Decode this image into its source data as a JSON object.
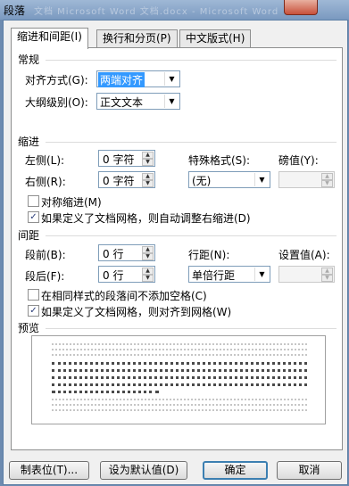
{
  "window": {
    "title": "段落",
    "background_caption": "文档 Microsoft Word 文档.docx - Microsoft Word",
    "close_glyph": "✕"
  },
  "tabs": [
    {
      "label": "缩进和间距(I)",
      "active": true
    },
    {
      "label": "换行和分页(P)",
      "active": false
    },
    {
      "label": "中文版式(H)",
      "active": false
    }
  ],
  "general": {
    "title": "常规",
    "alignment_label": "对齐方式(G):",
    "alignment_value": "两端对齐",
    "outline_label": "大纲级别(O):",
    "outline_value": "正文文本"
  },
  "indent": {
    "title": "缩进",
    "left_label": "左侧(L):",
    "left_value": "0 字符",
    "right_label": "右侧(R):",
    "right_value": "0 字符",
    "special_label": "特殊格式(S):",
    "special_value": "(无)",
    "by_label": "磅值(Y):",
    "by_value": "",
    "mirror_label": "对称缩进(M)",
    "mirror_checked": false,
    "auto_adjust_label": "如果定义了文档网格，则自动调整右缩进(D)",
    "auto_adjust_checked": true
  },
  "spacing": {
    "title": "间距",
    "before_label": "段前(B):",
    "before_value": "0 行",
    "after_label": "段后(F):",
    "after_value": "0 行",
    "line_label": "行距(N):",
    "line_value": "单倍行距",
    "at_label": "设置值(A):",
    "at_value": "",
    "no_space_label": "在相同样式的段落间不添加空格(C)",
    "no_space_checked": false,
    "snap_grid_label": "如果定义了文档网格，则对齐到网格(W)",
    "snap_grid_checked": true
  },
  "preview": {
    "title": "预览"
  },
  "buttons": {
    "tabs": "制表位(T)...",
    "set_default": "设为默认值(D)",
    "ok": "确定",
    "cancel": "取消"
  },
  "icons": {
    "checked": "✓",
    "arrow_down": "▼",
    "arrow_up": "▲"
  },
  "colors": {
    "window_frame": "#6d8bb0",
    "selection": "#3399ff",
    "close_button": "#c8503a"
  }
}
